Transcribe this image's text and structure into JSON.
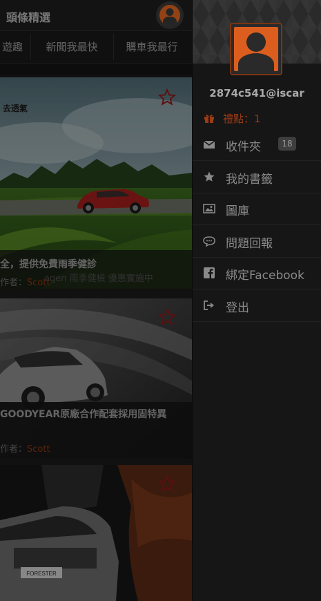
{
  "header": {
    "title": "頭條精選"
  },
  "tabs": [
    "遊趣",
    "新聞我最快",
    "購車我最行"
  ],
  "cards": [
    {
      "overlay_text": "去透氣",
      "caption": "全，提供免費雨季健診",
      "subcaption": "agen 雨季健檢 優惠實施中",
      "author_label": "作者：",
      "author": "Scott"
    },
    {
      "caption": "GOODYEAR原廠合作配套採用固特異",
      "author_label": "作者：",
      "author": "Scott"
    },
    {
      "badge_text": "FORESTER"
    }
  ],
  "drawer": {
    "username": "2874c541@iscar",
    "points_label": "禮點：1",
    "menu": [
      {
        "icon": "envelope-icon",
        "label": "收件夾",
        "badge": "18"
      },
      {
        "icon": "star-icon",
        "label": "我的書籤"
      },
      {
        "icon": "picture-icon",
        "label": "圖庫"
      },
      {
        "icon": "chat-icon",
        "label": "問題回報"
      },
      {
        "icon": "facebook-icon",
        "label": "綁定Facebook"
      },
      {
        "icon": "logout-icon",
        "label": "登出"
      }
    ]
  },
  "colors": {
    "accent": "#e0661f",
    "background": "#161616"
  }
}
